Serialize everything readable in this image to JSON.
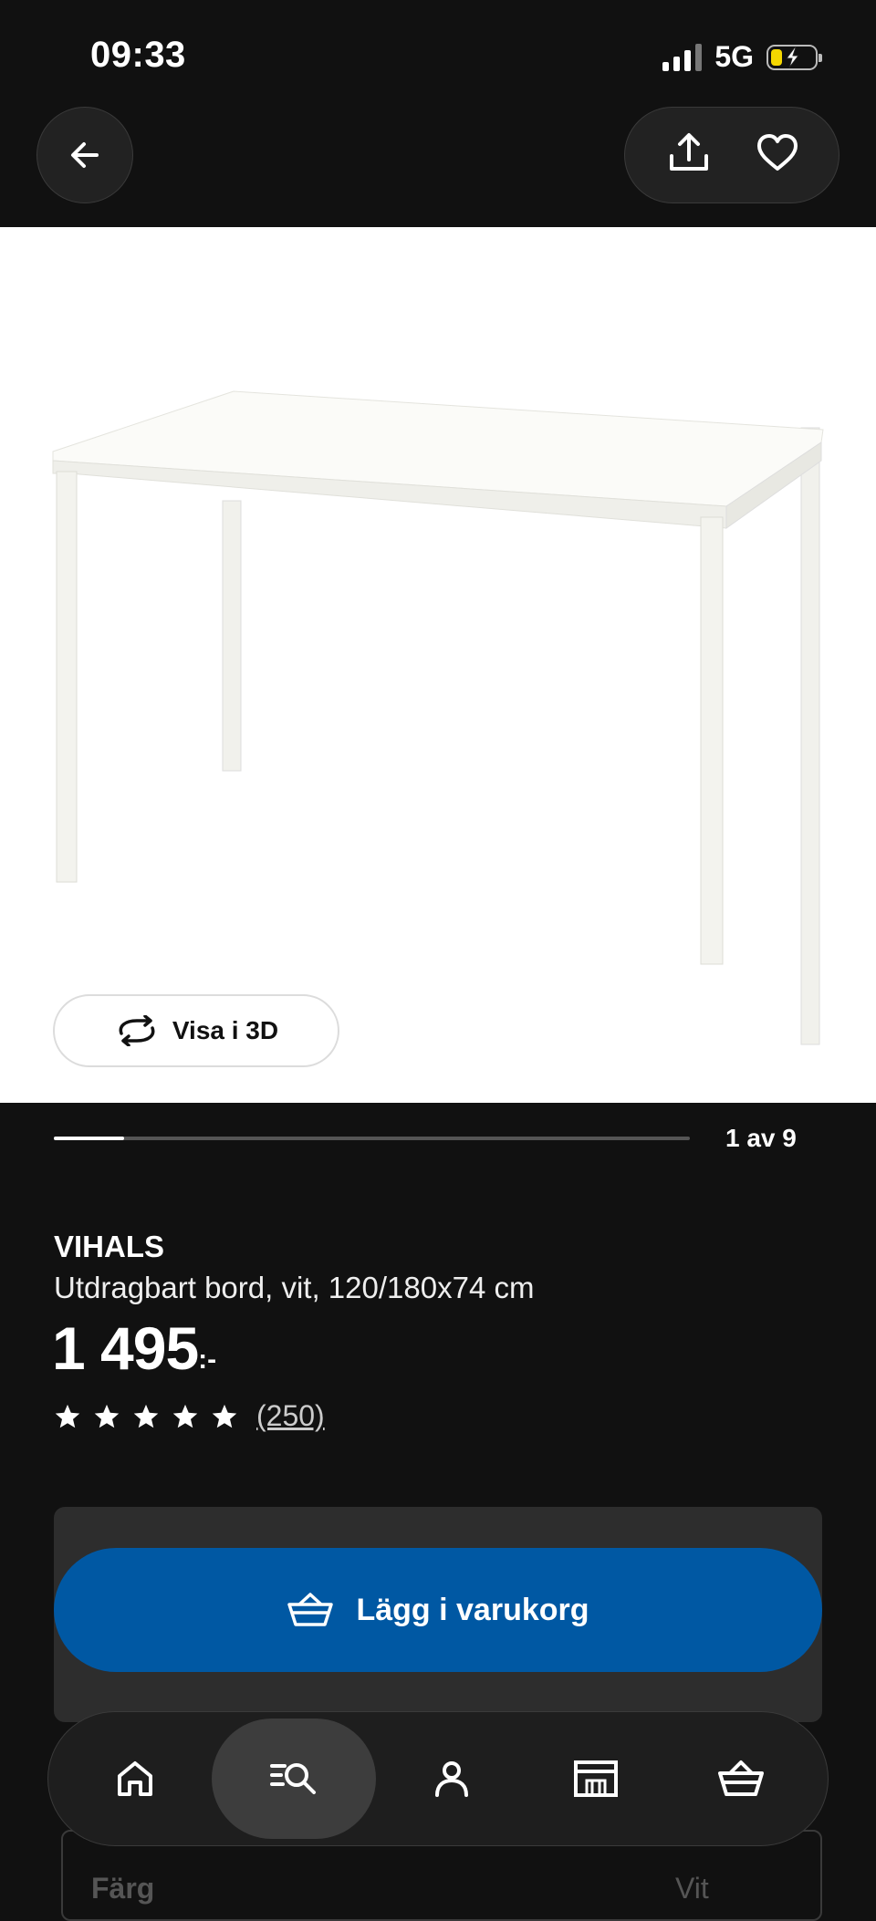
{
  "status_bar": {
    "time": "09:33",
    "network": "5G"
  },
  "product_image": {
    "alt": "VIHALS table",
    "view_3d_label": "Visa i 3D"
  },
  "pager": {
    "text": "1 av 9",
    "current": 1,
    "total": 9
  },
  "product": {
    "name": "VIHALS",
    "description": "Utdragbart bord, vit, 120/180x74 cm",
    "price": "1 495",
    "price_suffix": ":-",
    "rating_value": 5,
    "rating_max": 5,
    "rating_count": "(250)"
  },
  "actions": {
    "add_to_cart": "Lägg i varukorg"
  },
  "color_row": {
    "label": "Färg",
    "value": "Vit"
  },
  "bottom_nav": {
    "items": [
      "home-icon",
      "search-icon",
      "profile-icon",
      "store-icon",
      "cart-icon"
    ],
    "active": "search-icon"
  },
  "colors": {
    "background": "#111111",
    "primary": "#0058a3",
    "card": "#2d2d2d"
  }
}
